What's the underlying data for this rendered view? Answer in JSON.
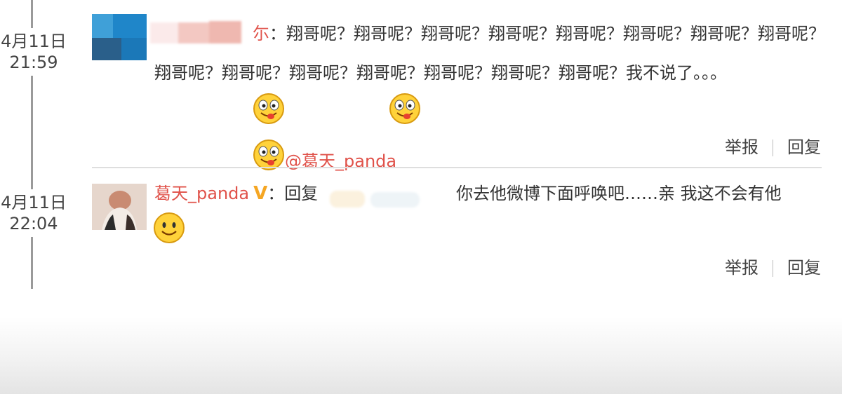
{
  "comments": [
    {
      "date": "4月11日",
      "time": "21:59",
      "username_fragment": "尓",
      "colon": "：",
      "text": "翔哥呢？翔哥呢？翔哥呢？翔哥呢？翔哥呢？翔哥呢？翔哥呢？翔哥呢？翔哥呢？翔哥呢？翔哥呢？翔哥呢？翔哥呢？翔哥呢？翔哥呢？我不说了。。。",
      "mention": "@葛天_panda",
      "emoticons": [
        "grin-tongue-icon",
        "grin-tongue-icon",
        "grin-tongue-icon"
      ],
      "actions": {
        "report": "举报",
        "reply": "回复"
      }
    },
    {
      "date": "4月11日",
      "time": "22:04",
      "username": "葛天_panda",
      "verified_badge": "V",
      "colon": "：",
      "reply_prefix": "回复",
      "text": "你去他微博下面呼唤吧……亲 我这不会有他",
      "emoticons": [
        "smile-icon"
      ],
      "actions": {
        "report": "举报",
        "reply": "回复"
      }
    }
  ],
  "colors": {
    "username": "#e0524a",
    "verified": "#f5a623",
    "timeline": "#9a9a9a"
  }
}
